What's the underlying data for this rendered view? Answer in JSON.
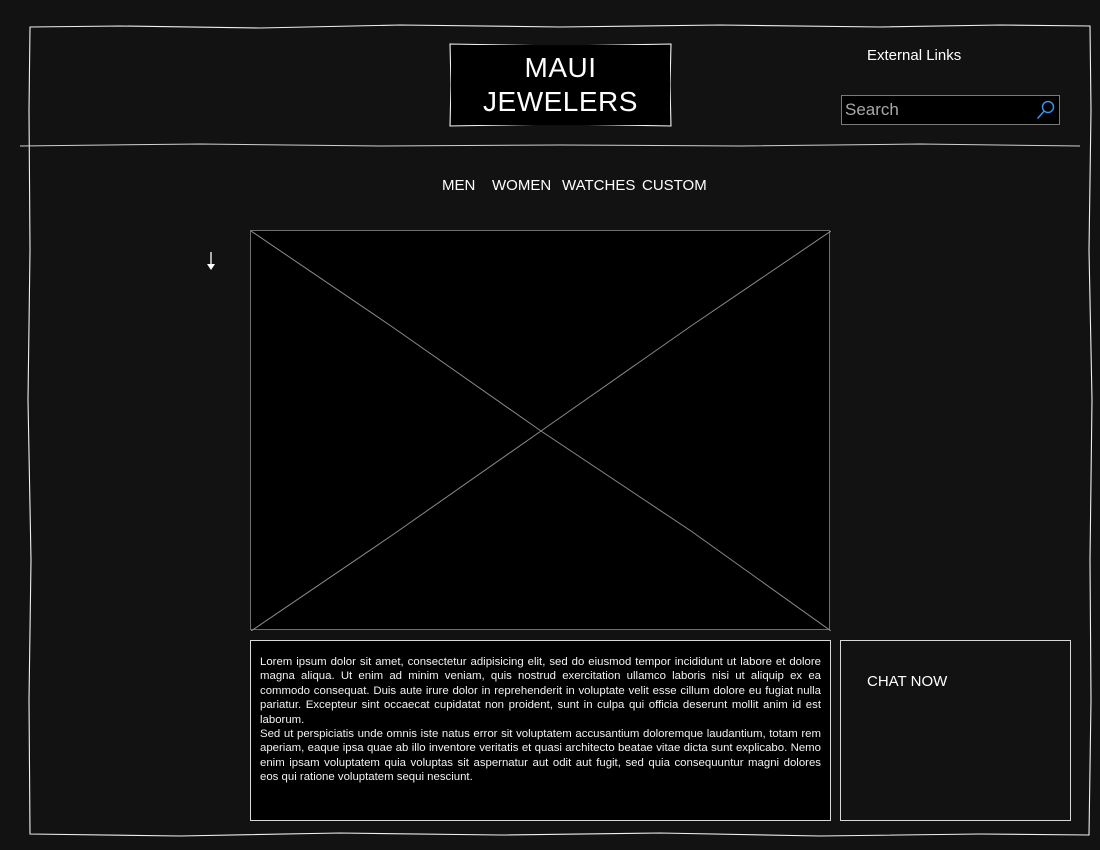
{
  "header": {
    "logo_text": "MAUI JEWELERS",
    "external_links_label": "External Links",
    "search": {
      "placeholder": "Search",
      "value": ""
    }
  },
  "nav": {
    "items": [
      {
        "label": "MEN"
      },
      {
        "label": "WOMEN"
      },
      {
        "label": "WATCHES"
      },
      {
        "label": "CUSTOM"
      }
    ]
  },
  "main": {
    "paragraphs": [
      "Lorem ipsum dolor sit amet, consectetur adipisicing elit, sed do eiusmod tempor incididunt ut labore et dolore magna aliqua. Ut enim ad minim veniam, quis nostrud exercitation ullamco laboris nisi ut aliquip ex ea commodo consequat. Duis aute irure dolor in reprehenderit in voluptate velit esse cillum dolore eu fugiat nulla pariatur. Excepteur sint occaecat cupidatat non proident, sunt in culpa qui officia deserunt mollit anim id est laborum.",
      "Sed ut perspiciatis unde omnis iste natus error sit voluptatem accusantium doloremque laudantium, totam rem aperiam, eaque ipsa quae ab illo inventore veritatis et quasi architecto beatae vitae dicta sunt explicabo. Nemo enim ipsam voluptatem quia voluptas sit aspernatur aut odit aut fugit, sed quia consequuntur magni dolores eos qui ratione voluptatem sequi nesciunt."
    ]
  },
  "chat": {
    "label": "CHAT NOW"
  },
  "icons": {
    "search": "search-icon",
    "down_arrow": "arrow-down-icon",
    "image_placeholder": "image-placeholder"
  },
  "colors": {
    "background": "#121212",
    "panel": "#000000",
    "text": "#ffffff",
    "accent": "#3d8fe6"
  }
}
